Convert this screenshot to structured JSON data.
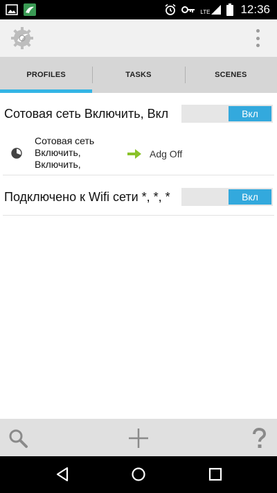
{
  "status_bar": {
    "left_icons": [
      "image-icon",
      "app-store-icon"
    ],
    "right_icons": [
      "alarm-icon",
      "key-icon",
      "signal-lte-icon",
      "battery-icon"
    ],
    "network_label": "LTE",
    "time": "12:36"
  },
  "action_bar": {
    "app_icon": "tasker-gear-icon",
    "menu_icon": "overflow-menu-icon"
  },
  "tabs": [
    {
      "label": "PROFILES",
      "active": true
    },
    {
      "label": "TASKS",
      "active": false
    },
    {
      "label": "SCENES",
      "active": false
    }
  ],
  "profiles": [
    {
      "title": "Сотовая сеть Включить, Вкл",
      "toggle_label": "Вкл",
      "enabled": true,
      "context_lines": [
        "Сотовая сеть",
        "Включить,",
        "Включить,"
      ],
      "task": "Adg Off"
    },
    {
      "title": "Подключено к Wifi сети *, *, *",
      "toggle_label": "Вкл",
      "enabled": true
    }
  ],
  "bottom_toolbar": {
    "icons": [
      "search-icon",
      "add-icon",
      "help-icon"
    ]
  },
  "nav_bar": {
    "icons": [
      "back-icon",
      "home-icon",
      "recents-icon"
    ]
  },
  "colors": {
    "accent": "#33b5e5",
    "toggle_on": "#33a9dd",
    "task_arrow": "#8ac22a"
  }
}
